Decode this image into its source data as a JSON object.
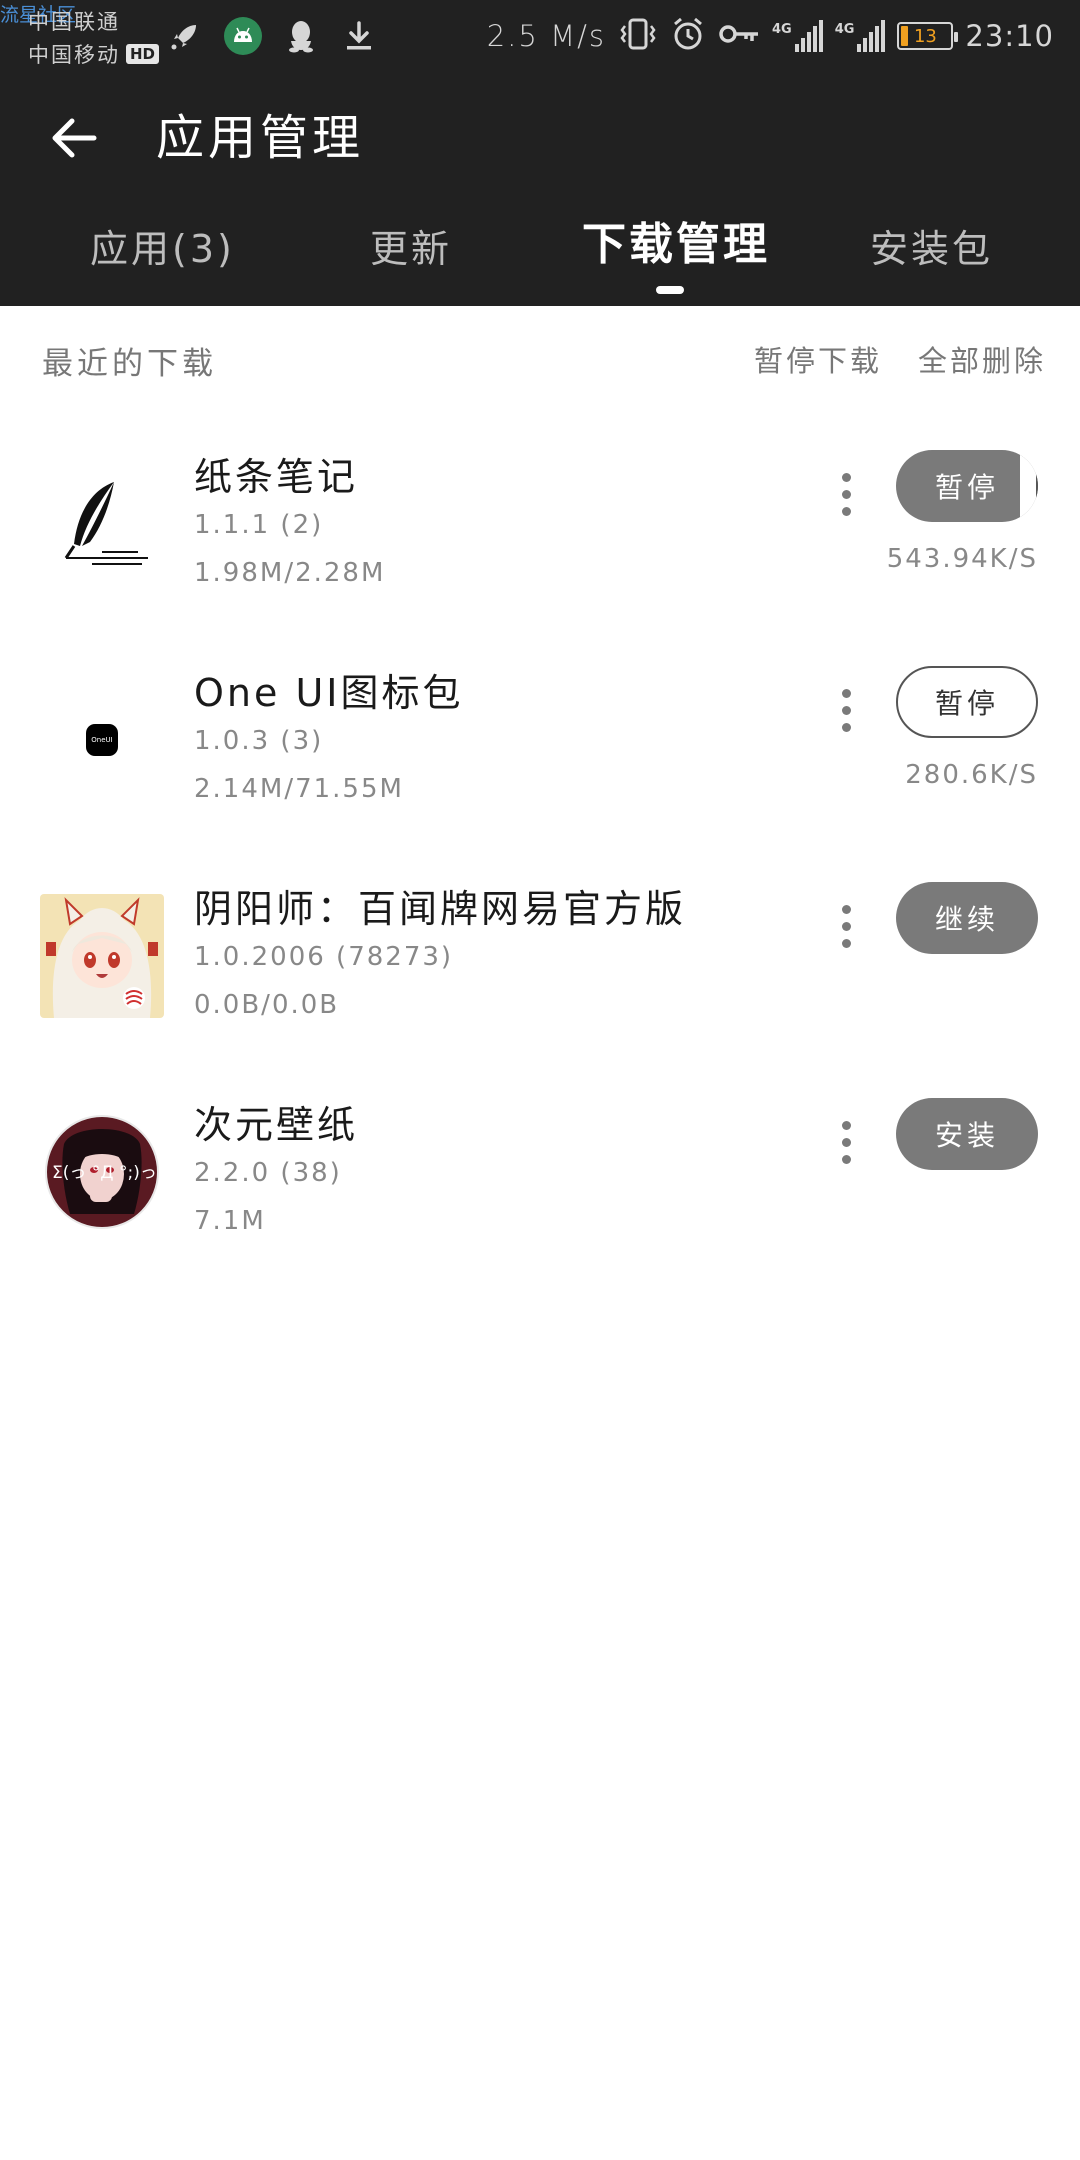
{
  "status_bar": {
    "watermark": "流星社区",
    "carrier_1": "中国联通",
    "carrier_2": "中国移动",
    "hd_badge": "HD",
    "net_speed": "2.5 M/s",
    "signal_label_1": "4G",
    "signal_label_2": "4G",
    "battery_level": "13",
    "time": "23:10"
  },
  "header": {
    "title": "应用管理"
  },
  "tabs": [
    {
      "label": "应用(3)",
      "active": false
    },
    {
      "label": "更新",
      "active": false
    },
    {
      "label": "下载管理",
      "active": true
    },
    {
      "label": "安装包",
      "active": false
    }
  ],
  "section": {
    "title": "最近的下载",
    "pause_all": "暂停下载",
    "delete_all": "全部删除"
  },
  "downloads": [
    {
      "name": "纸条笔记",
      "version": "1.1.1 (2)",
      "size": "1.98M/2.28M",
      "action": "暂停",
      "speed": "543.94K/S",
      "progress": 0.87
    },
    {
      "name": "One UI图标包",
      "version": "1.0.3 (3)",
      "size": "2.14M/71.55M",
      "action": "暂停",
      "speed": "280.6K/S",
      "progress": 0.03,
      "icon_text": "OneUI"
    },
    {
      "name": "阴阳师：百闻牌网易官方版",
      "version": "1.0.2006 (78273)",
      "size": "0.0B/0.0B",
      "action": "继续",
      "speed": ""
    },
    {
      "name": "次元壁纸",
      "version": "2.2.0 (38)",
      "size": "7.1M",
      "action": "安装",
      "speed": "",
      "icon_text": "Σ(っ °Д °;)っ"
    }
  ],
  "colors": {
    "header_bg": "#212121",
    "button_gray": "#7a7a7a",
    "battery_accent": "#f0a020"
  }
}
